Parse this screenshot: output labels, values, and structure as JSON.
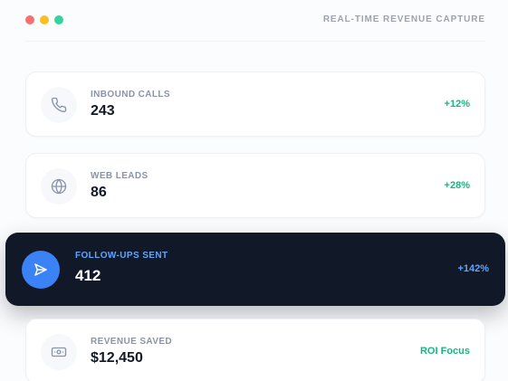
{
  "window": {
    "title": "REAL-TIME REVENUE CAPTURE"
  },
  "colors": {
    "accent_blue": "#3b82f6",
    "positive_green": "#10b981",
    "active_bg": "#111827"
  },
  "metrics": [
    {
      "label": "INBOUND CALLS",
      "value": "243",
      "delta": "+12%",
      "icon": "phone-icon"
    },
    {
      "label": "WEB LEADS",
      "value": "86",
      "delta": "+28%",
      "icon": "globe-icon"
    },
    {
      "label": "FOLLOW-UPS SENT",
      "value": "412",
      "delta": "+142%",
      "icon": "send-icon",
      "active": true
    },
    {
      "label": "REVENUE SAVED",
      "value": "$12,450",
      "delta": "ROI Focus",
      "icon": "money-icon"
    }
  ]
}
